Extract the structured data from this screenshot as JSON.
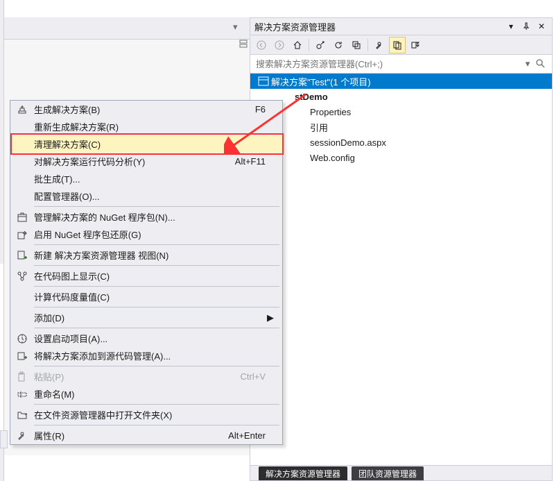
{
  "solution_explorer": {
    "title": "解决方案资源管理器",
    "window_buttons": {
      "menu": "▾",
      "pin": "📌",
      "close": "✕"
    },
    "toolbar": {
      "back": {
        "name": "nav-back-icon"
      },
      "forward": {
        "name": "nav-forward-icon"
      },
      "home": {
        "name": "home-icon"
      },
      "scope": {
        "name": "scope-icon"
      },
      "refresh": {
        "name": "refresh-icon"
      },
      "collapse": {
        "name": "collapse-all-icon"
      },
      "properties": {
        "name": "properties-icon"
      },
      "showall": {
        "name": "show-all-files-icon"
      },
      "preview": {
        "name": "preview-selected-icon"
      }
    },
    "search_placeholder": "搜索解决方案资源管理器(Ctrl+;)",
    "tree": {
      "solution_label": "解决方案\"Test\"(1 个项目)",
      "project_label": "stDemo",
      "children": [
        {
          "label": "Properties",
          "icon": "properties-node-icon"
        },
        {
          "label": "引用",
          "icon": "references-icon"
        },
        {
          "label": "sessionDemo.aspx",
          "icon": "aspx-file-icon"
        },
        {
          "label": "Web.config",
          "icon": "config-file-icon"
        }
      ]
    },
    "bottom_tabs": [
      "解决方案资源管理器",
      "团队资源管理器"
    ]
  },
  "context_menu": {
    "items": [
      {
        "icon": "build-icon",
        "label": "生成解决方案(B)",
        "shortcut": "F6"
      },
      {
        "icon": "",
        "label": "重新生成解决方案(R)",
        "shortcut": ""
      },
      {
        "icon": "",
        "label": "清理解决方案(C)",
        "shortcut": "",
        "highlighted": true
      },
      {
        "icon": "",
        "label": "对解决方案运行代码分析(Y)",
        "shortcut": "Alt+F11"
      },
      {
        "icon": "",
        "label": "批生成(T)...",
        "shortcut": ""
      },
      {
        "icon": "",
        "label": "配置管理器(O)...",
        "shortcut": ""
      },
      {
        "sep": true
      },
      {
        "icon": "nuget-icon",
        "label": "管理解决方案的 NuGet 程序包(N)...",
        "shortcut": ""
      },
      {
        "icon": "nuget-restore-icon",
        "label": "启用 NuGet 程序包还原(G)",
        "shortcut": ""
      },
      {
        "sep": true
      },
      {
        "icon": "new-view-icon",
        "label": "新建 解决方案资源管理器 视图(N)",
        "shortcut": ""
      },
      {
        "sep": true
      },
      {
        "icon": "codemap-icon",
        "label": "在代码图上显示(C)",
        "shortcut": ""
      },
      {
        "sep": true
      },
      {
        "icon": "",
        "label": "计算代码度量值(C)",
        "shortcut": ""
      },
      {
        "sep": true
      },
      {
        "icon": "",
        "label": "添加(D)",
        "shortcut": "",
        "submenu": true
      },
      {
        "sep": true
      },
      {
        "icon": "startup-icon",
        "label": "设置启动项目(A)...",
        "shortcut": ""
      },
      {
        "icon": "addsrc-icon",
        "label": "将解决方案添加到源代码管理(A)...",
        "shortcut": ""
      },
      {
        "sep": true
      },
      {
        "icon": "paste-icon",
        "label": "粘贴(P)",
        "shortcut": "Ctrl+V",
        "disabled": true
      },
      {
        "icon": "rename-icon",
        "label": "重命名(M)",
        "shortcut": ""
      },
      {
        "sep": true
      },
      {
        "icon": "open-folder-icon",
        "label": "在文件资源管理器中打开文件夹(X)",
        "shortcut": ""
      },
      {
        "sep": true
      },
      {
        "icon": "props-icon",
        "label": "属性(R)",
        "shortcut": "Alt+Enter"
      }
    ]
  }
}
